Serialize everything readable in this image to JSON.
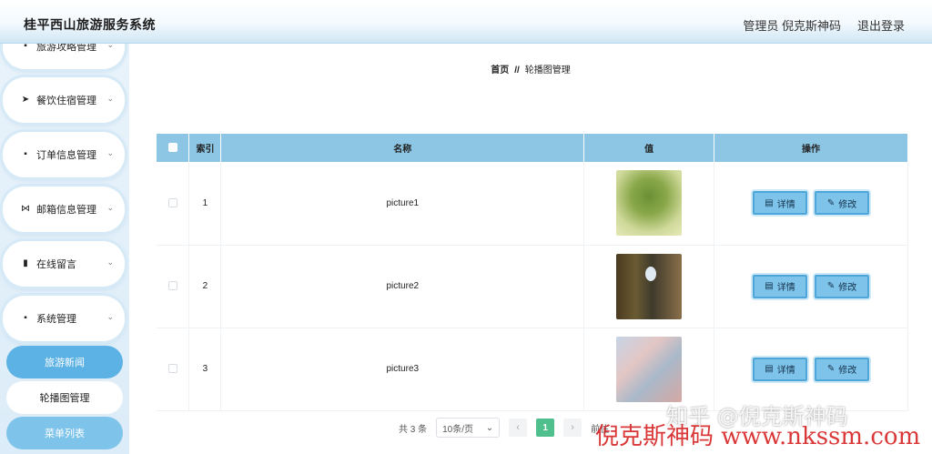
{
  "header": {
    "app_title": "桂平西山旅游服务系统",
    "user_label": "管理员 倪克斯神码",
    "logout_label": "退出登录"
  },
  "sidebar": {
    "menus": [
      {
        "label": "旅游攻略管理",
        "icon": "grid-icon"
      },
      {
        "label": "餐饮住宿管理",
        "icon": "send-icon"
      },
      {
        "label": "订单信息管理",
        "icon": "grid-icon"
      },
      {
        "label": "邮箱信息管理",
        "icon": "bowtie-icon"
      },
      {
        "label": "在线留言",
        "icon": "clipboard-icon"
      },
      {
        "label": "系统管理",
        "icon": "grid-icon"
      }
    ],
    "subs": [
      {
        "label": "旅游新闻"
      },
      {
        "label": "轮播图管理"
      },
      {
        "label": "菜单列表"
      }
    ]
  },
  "breadcrumb": {
    "home": "首页",
    "sep": "//",
    "current": "轮播图管理"
  },
  "table": {
    "headers": {
      "index": "索引",
      "name": "名称",
      "value": "值",
      "ops": "操作"
    },
    "rows": [
      {
        "index": "1",
        "name": "picture1"
      },
      {
        "index": "2",
        "name": "picture2"
      },
      {
        "index": "3",
        "name": "picture3"
      }
    ],
    "detail_label": "详情",
    "edit_label": "修改"
  },
  "pagination": {
    "total": "共 3 条",
    "page_size": "10条/页",
    "current_page": "1",
    "goto_label": "前往"
  },
  "watermarks": {
    "zhihu": "知乎 @倪克斯神码",
    "site": "倪克斯神码 www.nkssm.com"
  }
}
